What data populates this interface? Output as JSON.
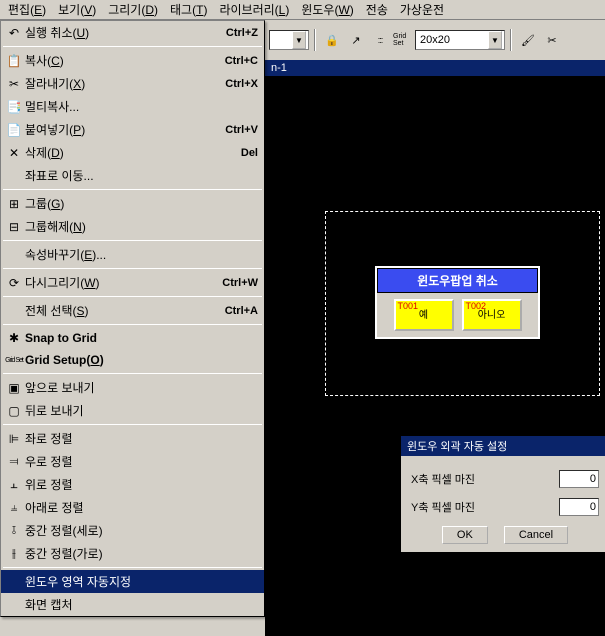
{
  "menubar": {
    "items": [
      {
        "label": "편집",
        "u": "E"
      },
      {
        "label": "보기",
        "u": "V"
      },
      {
        "label": "그리기",
        "u": "D"
      },
      {
        "label": "태그",
        "u": "T"
      },
      {
        "label": "라이브러리",
        "u": "L"
      },
      {
        "label": "윈도우",
        "u": "W"
      },
      {
        "label": "전송",
        "u": ""
      },
      {
        "label": "가상운전",
        "u": ""
      }
    ]
  },
  "toolbar": {
    "lock_icon": "🔒",
    "pointer_icon": "↗",
    "grid_dots": ":::",
    "grid_set_label": "Grid Set",
    "grid_combo": "20x20",
    "brush_icon": "🖌",
    "cut_icon": "✂"
  },
  "doc": {
    "title": "n-1"
  },
  "popup": {
    "title": "윈도우팝업 취소",
    "btn1_tag": "T001",
    "btn1_label": "예",
    "btn2_tag": "T002",
    "btn2_label": "아니오"
  },
  "dialog": {
    "title": "윈도우 외곽 자동 설정",
    "xlabel": "X축 픽셀 마진",
    "ylabel": "Y축 픽셀 마진",
    "xval": "0",
    "yval": "0",
    "ok": "OK",
    "cancel": "Cancel"
  },
  "dropdown": {
    "items": [
      {
        "icon": "↶",
        "label": "실행 취소",
        "u": "U",
        "shortcut": "Ctrl+Z"
      },
      {
        "sep": true
      },
      {
        "icon": "📋",
        "label": "복사",
        "u": "C",
        "shortcut": "Ctrl+C"
      },
      {
        "icon": "✂",
        "label": "잘라내기",
        "u": "X",
        "shortcut": "Ctrl+X"
      },
      {
        "icon": "📑",
        "label": "멀티복사...",
        "u": "",
        "shortcut": ""
      },
      {
        "icon": "📄",
        "label": "붙여넣기",
        "u": "P",
        "shortcut": "Ctrl+V"
      },
      {
        "icon": "✕",
        "label": "삭제",
        "u": "D",
        "shortcut": "Del"
      },
      {
        "icon": "",
        "label": "좌표로 이동...",
        "u": "",
        "shortcut": ""
      },
      {
        "sep": true
      },
      {
        "icon": "⊞",
        "label": "그룹",
        "u": "G",
        "shortcut": ""
      },
      {
        "icon": "⊟",
        "label": "그룹해제",
        "u": "N",
        "shortcut": ""
      },
      {
        "sep": true
      },
      {
        "icon": "",
        "label": "속성바꾸기",
        "u": "E",
        "label_suffix": "...",
        "shortcut": ""
      },
      {
        "sep": true
      },
      {
        "icon": "⟳",
        "label": "다시그리기",
        "u": "W",
        "shortcut": "Ctrl+W"
      },
      {
        "sep": true
      },
      {
        "icon": "",
        "label": "전체 선택",
        "u": "S",
        "shortcut": "Ctrl+A"
      },
      {
        "sep": true
      },
      {
        "icon": "✱",
        "label": "Snap to Grid",
        "u": "",
        "shortcut": "",
        "bold": true
      },
      {
        "icon": "Grid Set",
        "label": "Grid Setup",
        "u": "O",
        "label_suffix": "",
        "shortcut": "",
        "bold": true,
        "grid": true
      },
      {
        "sep": true
      },
      {
        "icon": "▣",
        "label": "앞으로 보내기",
        "u": "",
        "shortcut": ""
      },
      {
        "icon": "▢",
        "label": "뒤로 보내기",
        "u": "",
        "shortcut": ""
      },
      {
        "sep": true
      },
      {
        "icon": "⊫",
        "label": "좌로 정렬",
        "u": "",
        "shortcut": ""
      },
      {
        "icon": "⫤",
        "label": "우로 정렬",
        "u": "",
        "shortcut": ""
      },
      {
        "icon": "⫠",
        "label": "위로 정렬",
        "u": "",
        "shortcut": ""
      },
      {
        "icon": "⫨",
        "label": "아래로 정렬",
        "u": "",
        "shortcut": ""
      },
      {
        "icon": "⫱",
        "label": "중간 정렬(세로)",
        "u": "",
        "shortcut": ""
      },
      {
        "icon": "⫲",
        "label": "중간 정렬(가로)",
        "u": "",
        "shortcut": ""
      },
      {
        "sep": true
      },
      {
        "icon": "",
        "label": "윈도우 영역 자동지정",
        "u": "",
        "shortcut": "",
        "highlight": true
      },
      {
        "icon": "",
        "label": "화면 캡처",
        "u": "",
        "shortcut": ""
      }
    ]
  }
}
